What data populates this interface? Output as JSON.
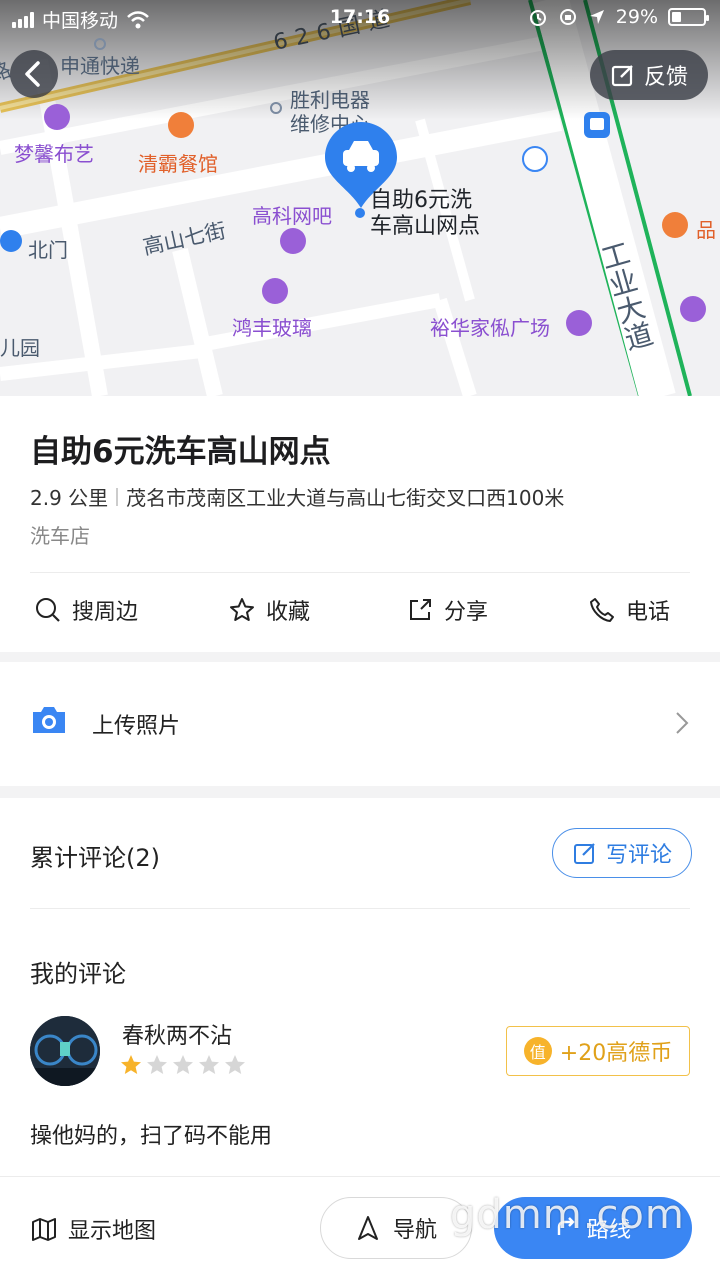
{
  "status_bar": {
    "carrier": "中国移动",
    "time": "17:16",
    "battery": "29%",
    "battery_level": 0.29
  },
  "map": {
    "feedback_label": "反馈",
    "streets": {
      "top_road": "626",
      "top_road_suffix": "国道",
      "gaoshan": "高山七街",
      "industrial": "工业大道"
    },
    "pois": {
      "shentong": "申通快递",
      "mengxin": "梦馨布艺",
      "qingba": "清霸餐馆",
      "shengli_1": "胜利电器",
      "shengli_2": "维修中心",
      "gaoke": "高科网吧",
      "beimen": "北门",
      "hongfeng": "鸿丰玻璃",
      "yuhua": "裕华家俬广场",
      "pin_right": "品",
      "park": "儿园",
      "edge_left": "路"
    },
    "selected_label_1": "自助6元洗",
    "selected_label_2": "车高山网点"
  },
  "place": {
    "title": "自助6元洗车高山网点",
    "distance": "2.9 公里",
    "address": "茂名市茂南区工业大道与高山七街交叉口西100米",
    "category": "洗车店"
  },
  "actions": [
    {
      "label": "搜周边",
      "icon": "search-icon"
    },
    {
      "label": "收藏",
      "icon": "star-icon"
    },
    {
      "label": "分享",
      "icon": "share-icon"
    },
    {
      "label": "电话",
      "icon": "phone-icon"
    }
  ],
  "upload": {
    "label": "上传照片",
    "icon": "camera-icon"
  },
  "reviews": {
    "count_label": "累计评论(2)",
    "write_label": "写评论",
    "my_review_title": "我的评论",
    "user_name": "春秋两不沾",
    "rating": 1,
    "rating_max": 5,
    "coin_icon_text": "值",
    "coin_reward": "+20高德币",
    "text": "操他妈的，扫了码不能用"
  },
  "bottom_bar": {
    "show_map": "显示地图",
    "navigate": "导航",
    "route": "路线"
  },
  "watermark": "gdmm.com",
  "colors": {
    "accent_blue": "#3a86f3",
    "coin_gold": "#f7b32b",
    "poi_purple": "#8a4fd0",
    "poi_orange": "#e1602a",
    "road_green": "#1fb35a"
  }
}
